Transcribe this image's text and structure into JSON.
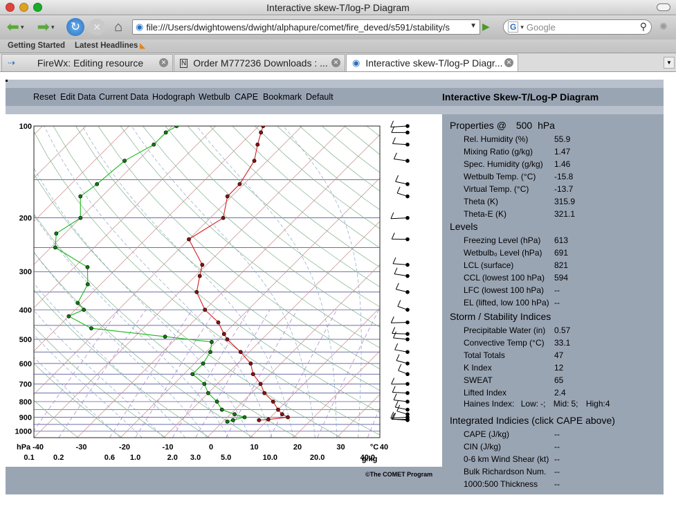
{
  "window": {
    "title": "Interactive skew-T/log-P Diagram"
  },
  "toolbar": {
    "url": "file:///Users/dwightowens/dwight/alphapure/comet/fire_deved/s591/stability/s",
    "search_placeholder": "Google"
  },
  "bookmarks": [
    "Getting Started",
    "Latest Headlines"
  ],
  "tabs": [
    {
      "label": "FireWx: Editing resource",
      "active": false
    },
    {
      "label": "Order M777236 Downloads : ...",
      "active": false
    },
    {
      "label": "Interactive skew-T/log-P Diagr...",
      "active": true
    }
  ],
  "app": {
    "menu": [
      "Reset",
      "Edit Data",
      "Current Data",
      "Hodograph",
      "Wetbulb",
      "CAPE",
      "Bookmark",
      "Default"
    ],
    "title": "Interactive Skew-T/Log-P Diagram",
    "copyright": "©The COMET Program"
  },
  "properties": {
    "heading_prefix": "Properties @",
    "level": "500",
    "unit": "hPa",
    "rows": [
      {
        "label": "Rel. Humidity (%)",
        "value": "55.9"
      },
      {
        "label": "Mixing Ratio (g/kg)",
        "value": "1.47"
      },
      {
        "label": "Spec. Humidity (g/kg)",
        "value": "1.46"
      },
      {
        "label": "Wetbulb Temp. (°C)",
        "value": "-15.8"
      },
      {
        "label": "Virtual Temp. (°C)",
        "value": "-13.7"
      },
      {
        "label": "Theta (K)",
        "value": "315.9"
      },
      {
        "label": "Theta-E (K)",
        "value": "321.1"
      }
    ]
  },
  "levels": {
    "heading": "Levels",
    "rows": [
      {
        "label": "Freezing Level (hPa)",
        "value": "613"
      },
      {
        "label": "Wetbulb₀ Level (hPa)",
        "value": "691"
      },
      {
        "label": "LCL (surface)",
        "value": "821"
      },
      {
        "label": "CCL (lowest 100 hPa)",
        "value": "594"
      },
      {
        "label": "LFC (lowest 100 hPa)",
        "value": "--"
      },
      {
        "label": "EL (lifted, low 100 hPa)",
        "value": "--"
      }
    ]
  },
  "indices": {
    "heading": "Storm / Stability Indices",
    "rows": [
      {
        "label": "Precipitable Water (in)",
        "value": "0.57"
      },
      {
        "label": "Convective Temp (°C)",
        "value": "33.1"
      },
      {
        "label": "Total Totals",
        "value": "47"
      },
      {
        "label": "K Index",
        "value": "12"
      },
      {
        "label": "SWEAT",
        "value": "65"
      },
      {
        "label": "Lifted Index",
        "value": "2.4"
      }
    ],
    "haines": {
      "label": "Haines Index:",
      "low_label": "Low:",
      "low": "-",
      "mid_label": "Mid:",
      "mid": "5",
      "high_label": "High:",
      "high": "4"
    }
  },
  "integrated": {
    "heading": "Integrated Indicies (click CAPE above)",
    "rows": [
      {
        "label": "CAPE (J/kg)",
        "value": "--"
      },
      {
        "label": "CIN (J/kg)",
        "value": "--"
      },
      {
        "label": "0-6 km Wind Shear (kt)",
        "value": "--"
      },
      {
        "label": "Bulk Richardson Num.",
        "value": "--"
      },
      {
        "label": "1000:500 Thickness",
        "value": "--"
      }
    ]
  },
  "chart_data": {
    "type": "line",
    "title": "",
    "xlabel": "°C",
    "ylabel": "hPa",
    "pressure_ticks": [
      "100",
      "200",
      "300",
      "400",
      "500",
      "600",
      "700",
      "800",
      "900",
      "1000"
    ],
    "temperature_ticks": [
      "-40",
      "-30",
      "-20",
      "-10",
      "0",
      "10",
      "20",
      "30",
      "40"
    ],
    "mixing_ratio_ticks": [
      "0.1",
      "0.2",
      "0.6",
      "1.0",
      "2.0",
      "3.0",
      "5.0",
      "10.0",
      "20.0",
      "40.0"
    ],
    "mixing_ratio_unit": "g/kg",
    "xlim": [
      -40,
      40
    ],
    "ylim": [
      1050,
      100
    ],
    "series": [
      {
        "color": "#d41c1c",
        "points": [
          {
            "p": 100,
            "t": -59
          },
          {
            "p": 105,
            "t": -58
          },
          {
            "p": 115,
            "t": -56
          },
          {
            "p": 130,
            "t": -53
          },
          {
            "p": 155,
            "t": -51
          },
          {
            "p": 170,
            "t": -51
          },
          {
            "p": 200,
            "t": -47
          },
          {
            "p": 235,
            "t": -50
          },
          {
            "p": 285,
            "t": -41
          },
          {
            "p": 310,
            "t": -39
          },
          {
            "p": 350,
            "t": -36
          },
          {
            "p": 400,
            "t": -30
          },
          {
            "p": 440,
            "t": -24
          },
          {
            "p": 480,
            "t": -20
          },
          {
            "p": 500,
            "t": -18
          },
          {
            "p": 550,
            "t": -12
          },
          {
            "p": 600,
            "t": -7
          },
          {
            "p": 650,
            "t": -4
          },
          {
            "p": 700,
            "t": 0
          },
          {
            "p": 750,
            "t": 3
          },
          {
            "p": 800,
            "t": 7
          },
          {
            "p": 850,
            "t": 10
          },
          {
            "p": 880,
            "t": 12
          },
          {
            "p": 900,
            "t": 14
          },
          {
            "p": 915,
            "t": 10
          },
          {
            "p": 920,
            "t": 8
          }
        ]
      },
      {
        "color": "#18b818",
        "points": [
          {
            "p": 100,
            "t": -79
          },
          {
            "p": 105,
            "t": -80
          },
          {
            "p": 115,
            "t": -80
          },
          {
            "p": 130,
            "t": -83
          },
          {
            "p": 155,
            "t": -84
          },
          {
            "p": 170,
            "t": -85
          },
          {
            "p": 200,
            "t": -80
          },
          {
            "p": 225,
            "t": -82
          },
          {
            "p": 250,
            "t": -79
          },
          {
            "p": 290,
            "t": -67
          },
          {
            "p": 330,
            "t": -63
          },
          {
            "p": 380,
            "t": -61
          },
          {
            "p": 400,
            "t": -58
          },
          {
            "p": 420,
            "t": -60
          },
          {
            "p": 460,
            "t": -52
          },
          {
            "p": 490,
            "t": -33
          },
          {
            "p": 510,
            "t": -21
          },
          {
            "p": 550,
            "t": -19
          },
          {
            "p": 600,
            "t": -18
          },
          {
            "p": 650,
            "t": -18
          },
          {
            "p": 700,
            "t": -13
          },
          {
            "p": 750,
            "t": -10
          },
          {
            "p": 800,
            "t": -6
          },
          {
            "p": 850,
            "t": -3
          },
          {
            "p": 880,
            "t": 1
          },
          {
            "p": 900,
            "t": 4
          },
          {
            "p": 920,
            "t": 2
          },
          {
            "p": 930,
            "t": 1
          }
        ]
      }
    ]
  }
}
